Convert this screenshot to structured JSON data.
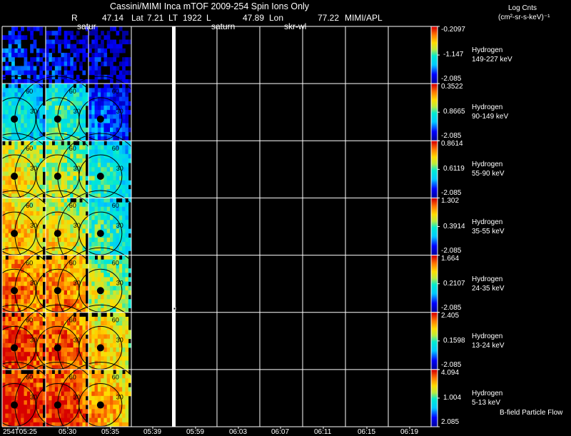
{
  "header": {
    "title": "Cassini/MIMI Inca mTOF  2009-254   Spin   Ions Only",
    "r_label": "R",
    "r_value": "47.14",
    "lat_label": "Lat",
    "lat_value": "7.21",
    "lt_label": "LT",
    "lt_value": "1922",
    "l_label": "L",
    "lon_value": "47.89",
    "lon_label": "Lon",
    "ref_value": "77.22",
    "source": "MIMI/APL",
    "target_labels": [
      "satur",
      "saturn",
      "skr-wl"
    ]
  },
  "colorbar_title": "Log Cnts",
  "colorbar_units": "(cm²-sr-s-keV)⁻¹",
  "footer_label": "B-field Particle Flow",
  "time_labels": [
    "254T05:25",
    "05:30",
    "05:35",
    "05:39",
    "05:59",
    "06:03",
    "06:07",
    "06:11",
    "06:15",
    "06:19"
  ],
  "colors": {
    "background": "#000000",
    "grid": "#ffffff",
    "marker": "#ffffff"
  },
  "chart_data": {
    "type": "heatmap",
    "title": "Cassini/MIMI Inca mTOF  2009-254   Spin   Ions Only",
    "time_axis": [
      "254T05:25",
      "05:30",
      "05:35",
      "05:39",
      "05:59",
      "06:03",
      "06:07",
      "06:11",
      "06:15",
      "06:19"
    ],
    "image_frames_with_data": 3,
    "colormap": "rainbow (blue low → red high)",
    "contour_labels": [
      "30",
      "60"
    ],
    "panels": [
      {
        "species": "Hydrogen",
        "energy": "149-227 keV",
        "cmax": "-0.2097",
        "cmid": "-1.147",
        "cmin": "-2.085",
        "level": [
          0.12,
          0.08,
          0.03
        ]
      },
      {
        "species": "Hydrogen",
        "energy": "90-149 keV",
        "cmax": "0.3522",
        "cmid": "0.8665",
        "cmin": "-2.085",
        "level": [
          0.35,
          0.42,
          0.13
        ]
      },
      {
        "species": "Hydrogen",
        "energy": "55-90 keV",
        "cmax": "0.8614",
        "cmid": "0.6119",
        "cmin": "-2.085",
        "level": [
          0.62,
          0.55,
          0.4
        ]
      },
      {
        "species": "Hydrogen",
        "energy": "35-55 keV",
        "cmax": "1.302",
        "cmid": "0.3914",
        "cmin": "-2.085",
        "level": [
          0.68,
          0.62,
          0.42
        ]
      },
      {
        "species": "Hydrogen",
        "energy": "24-35 keV",
        "cmax": "1.664",
        "cmid": "0.2107",
        "cmin": "-2.085",
        "level": [
          0.8,
          0.77,
          0.55
        ]
      },
      {
        "species": "Hydrogen",
        "energy": "13-24 keV",
        "cmax": "2.405",
        "cmid": "0.1598",
        "cmin": "-2.085",
        "level": [
          0.88,
          0.83,
          0.66
        ]
      },
      {
        "species": "Hydrogen",
        "energy": "5-13 keV",
        "cmax": "4.094",
        "cmid": "1.004",
        "cmin": "2.085",
        "level": [
          0.92,
          0.88,
          0.72
        ]
      }
    ]
  }
}
